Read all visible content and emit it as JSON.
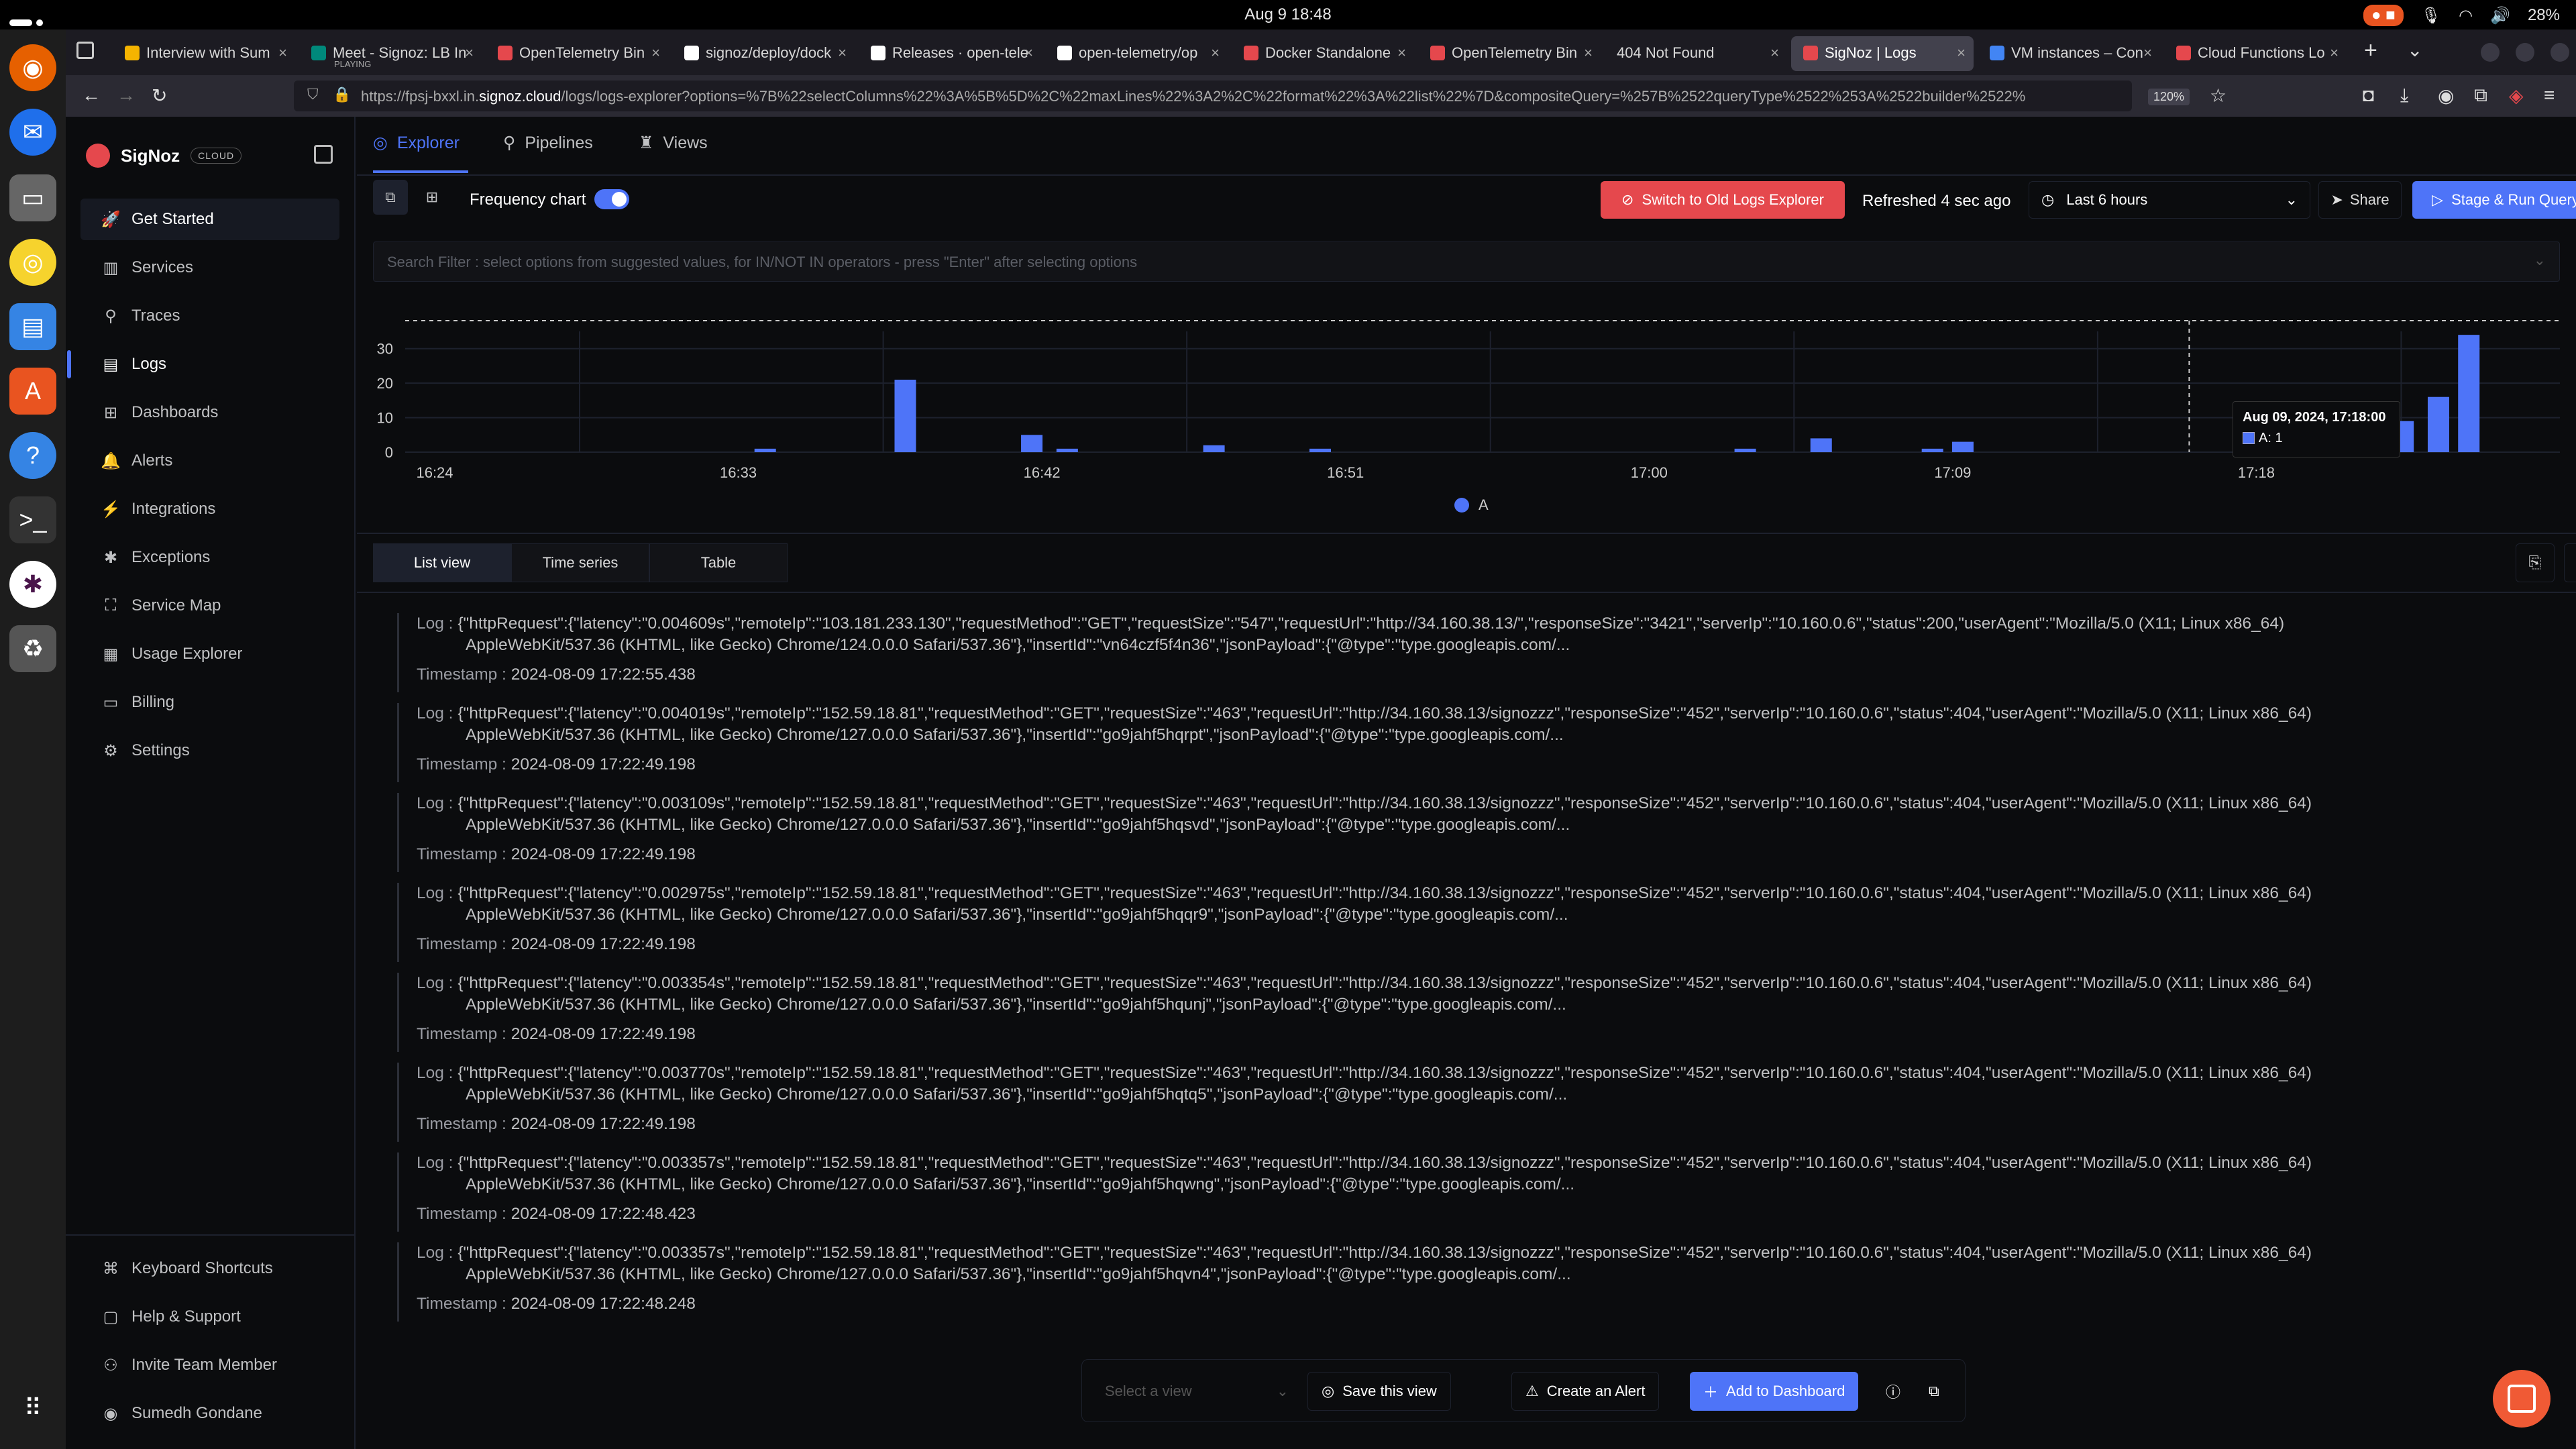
{
  "os": {
    "clock": "Aug 9  18:48",
    "battery": "28%"
  },
  "browser": {
    "tabs": [
      {
        "title": "Interview with Sum",
        "color": "#f5b400"
      },
      {
        "title": "Meet - Signoz: LB In",
        "sub": "PLAYING",
        "color": "#00897b"
      },
      {
        "title": "OpenTelemetry Bin",
        "color": "#e5484d"
      },
      {
        "title": "signoz/deploy/dock",
        "color": "#ffffff"
      },
      {
        "title": "Releases · open-tele",
        "color": "#ffffff"
      },
      {
        "title": "open-telemetry/op",
        "color": "#ffffff"
      },
      {
        "title": "Docker Standalone",
        "color": "#e5484d"
      },
      {
        "title": "OpenTelemetry Bin",
        "color": "#e5484d"
      },
      {
        "title": "404 Not Found",
        "color": ""
      },
      {
        "title": "SigNoz | Logs",
        "color": "#e5484d"
      },
      {
        "title": "VM instances – Con",
        "color": "#4285f4"
      },
      {
        "title": "Cloud Functions Lo",
        "color": "#e5484d"
      }
    ],
    "url_prefix": "https://fpsj-bxxl.in.",
    "url_domain": "signoz.cloud",
    "url_rest": "/logs/logs-explorer?options=%7B%22selectColumns%22%3A%5B%5D%2C%22maxLines%22%3A2%2C%22format%22%3A%22list%22%7D&compositeQuery=%257B%2522queryType%2522%253A%2522builder%2522%",
    "zoom": "120%"
  },
  "sidebar": {
    "brand": "SigNoz",
    "badge": "CLOUD",
    "items": [
      {
        "label": "Get Started",
        "icon": "rocket-icon",
        "glyph": "🚀"
      },
      {
        "label": "Services",
        "icon": "bar-chart-icon",
        "glyph": "▥"
      },
      {
        "label": "Traces",
        "icon": "traces-icon",
        "glyph": "⚲"
      },
      {
        "label": "Logs",
        "icon": "logs-icon",
        "glyph": "▤"
      },
      {
        "label": "Dashboards",
        "icon": "dashboard-icon",
        "glyph": "⊞"
      },
      {
        "label": "Alerts",
        "icon": "bell-icon",
        "glyph": "🔔"
      },
      {
        "label": "Integrations",
        "icon": "plug-icon",
        "glyph": "⚡"
      },
      {
        "label": "Exceptions",
        "icon": "bug-icon",
        "glyph": "✱"
      },
      {
        "label": "Service Map",
        "icon": "map-icon",
        "glyph": "⛶"
      },
      {
        "label": "Usage Explorer",
        "icon": "usage-icon",
        "glyph": "▦"
      },
      {
        "label": "Billing",
        "icon": "billing-icon",
        "glyph": "▭"
      },
      {
        "label": "Settings",
        "icon": "gear-icon",
        "glyph": "⚙"
      }
    ],
    "bottom": [
      {
        "label": "Keyboard Shortcuts",
        "icon": "keyboard-icon",
        "glyph": "⌘"
      },
      {
        "label": "Help & Support",
        "icon": "help-icon",
        "glyph": "▢"
      },
      {
        "label": "Invite Team Member",
        "icon": "invite-icon",
        "glyph": "⚇"
      },
      {
        "label": "Sumedh Gondane",
        "icon": "user-icon",
        "glyph": "◉"
      }
    ]
  },
  "header": {
    "tabs": [
      "Explorer",
      "Pipelines",
      "Views"
    ],
    "frequency_label": "Frequency chart",
    "switch_label": "Switch to Old Logs Explorer",
    "refreshed": "Refreshed 4 sec ago",
    "time_range": "Last 6 hours",
    "share": "Share",
    "run": "Stage & Run Query",
    "search_placeholder": "Search Filter : select options from suggested values, for IN/NOT IN operators - press \"Enter\" after selecting options"
  },
  "chart_data": {
    "type": "bar",
    "series": [
      {
        "name": "A",
        "color": "#4e74f8"
      }
    ],
    "yticks": [
      0,
      10,
      20,
      30
    ],
    "ylim": [
      0,
      35
    ],
    "xticks": [
      "16:24",
      "16:33",
      "16:42",
      "16:51",
      "17:00",
      "17:09",
      "17:18"
    ],
    "tooltip": {
      "time": "Aug 09, 2024, 17:18:00",
      "value": "A: 1"
    },
    "bars": [
      {
        "x": 16.33,
        "v": 1
      },
      {
        "x": 23.25,
        "v": 21
      },
      {
        "x": 29.5,
        "v": 5
      },
      {
        "x": 31.25,
        "v": 1
      },
      {
        "x": 38.5,
        "v": 2
      },
      {
        "x": 43.75,
        "v": 1
      },
      {
        "x": 64.75,
        "v": 1
      },
      {
        "x": 68.5,
        "v": 4
      },
      {
        "x": 74.0,
        "v": 1
      },
      {
        "x": 75.5,
        "v": 3
      },
      {
        "x": 94.5,
        "v": 1
      },
      {
        "x": 97.25,
        "v": 9
      },
      {
        "x": 99.0,
        "v": 16
      },
      {
        "x": 100.5,
        "v": 34
      }
    ]
  },
  "views": {
    "tabs": [
      "List view",
      "Time series",
      "Table"
    ]
  },
  "logs": [
    {
      "line1": "{\"httpRequest\":{\"latency\":\"0.004609s\",\"remoteIp\":\"103.181.233.130\",\"requestMethod\":\"GET\",\"requestSize\":\"547\",\"requestUrl\":\"http://34.160.38.13/\",\"responseSize\":\"3421\",\"serverIp\":\"10.160.0.6\",\"status\":200,\"userAgent\":\"Mozilla/5.0 (X11; Linux x86_64)",
      "line2": "AppleWebKit/537.36 (KHTML, like Gecko) Chrome/124.0.0.0 Safari/537.36\"},\"insertId\":\"vn64czf5f4n36\",\"jsonPayload\":{\"@type\":\"type.googleapis.com/...",
      "ts": "2024-08-09 17:22:55.438"
    },
    {
      "line1": "{\"httpRequest\":{\"latency\":\"0.004019s\",\"remoteIp\":\"152.59.18.81\",\"requestMethod\":\"GET\",\"requestSize\":\"463\",\"requestUrl\":\"http://34.160.38.13/signozzz\",\"responseSize\":\"452\",\"serverIp\":\"10.160.0.6\",\"status\":404,\"userAgent\":\"Mozilla/5.0 (X11; Linux x86_64)",
      "line2": "AppleWebKit/537.36 (KHTML, like Gecko) Chrome/127.0.0.0 Safari/537.36\"},\"insertId\":\"go9jahf5hqrpt\",\"jsonPayload\":{\"@type\":\"type.googleapis.com/...",
      "ts": "2024-08-09 17:22:49.198"
    },
    {
      "line1": "{\"httpRequest\":{\"latency\":\"0.003109s\",\"remoteIp\":\"152.59.18.81\",\"requestMethod\":\"GET\",\"requestSize\":\"463\",\"requestUrl\":\"http://34.160.38.13/signozzz\",\"responseSize\":\"452\",\"serverIp\":\"10.160.0.6\",\"status\":404,\"userAgent\":\"Mozilla/5.0 (X11; Linux x86_64)",
      "line2": "AppleWebKit/537.36 (KHTML, like Gecko) Chrome/127.0.0.0 Safari/537.36\"},\"insertId\":\"go9jahf5hqsvd\",\"jsonPayload\":{\"@type\":\"type.googleapis.com/...",
      "ts": "2024-08-09 17:22:49.198"
    },
    {
      "line1": "{\"httpRequest\":{\"latency\":\"0.002975s\",\"remoteIp\":\"152.59.18.81\",\"requestMethod\":\"GET\",\"requestSize\":\"463\",\"requestUrl\":\"http://34.160.38.13/signozzz\",\"responseSize\":\"452\",\"serverIp\":\"10.160.0.6\",\"status\":404,\"userAgent\":\"Mozilla/5.0 (X11; Linux x86_64)",
      "line2": "AppleWebKit/537.36 (KHTML, like Gecko) Chrome/127.0.0.0 Safari/537.36\"},\"insertId\":\"go9jahf5hqqr9\",\"jsonPayload\":{\"@type\":\"type.googleapis.com/...",
      "ts": "2024-08-09 17:22:49.198"
    },
    {
      "line1": "{\"httpRequest\":{\"latency\":\"0.003354s\",\"remoteIp\":\"152.59.18.81\",\"requestMethod\":\"GET\",\"requestSize\":\"463\",\"requestUrl\":\"http://34.160.38.13/signozzz\",\"responseSize\":\"452\",\"serverIp\":\"10.160.0.6\",\"status\":404,\"userAgent\":\"Mozilla/5.0 (X11; Linux x86_64)",
      "line2": "AppleWebKit/537.36 (KHTML, like Gecko) Chrome/127.0.0.0 Safari/537.36\"},\"insertId\":\"go9jahf5hqunj\",\"jsonPayload\":{\"@type\":\"type.googleapis.com/...",
      "ts": "2024-08-09 17:22:49.198"
    },
    {
      "line1": "{\"httpRequest\":{\"latency\":\"0.003770s\",\"remoteIp\":\"152.59.18.81\",\"requestMethod\":\"GET\",\"requestSize\":\"463\",\"requestUrl\":\"http://34.160.38.13/signozzz\",\"responseSize\":\"452\",\"serverIp\":\"10.160.0.6\",\"status\":404,\"userAgent\":\"Mozilla/5.0 (X11; Linux x86_64)",
      "line2": "AppleWebKit/537.36 (KHTML, like Gecko) Chrome/127.0.0.0 Safari/537.36\"},\"insertId\":\"go9jahf5hqtq5\",\"jsonPayload\":{\"@type\":\"type.googleapis.com/...",
      "ts": "2024-08-09 17:22:49.198"
    },
    {
      "line1": "{\"httpRequest\":{\"latency\":\"0.003357s\",\"remoteIp\":\"152.59.18.81\",\"requestMethod\":\"GET\",\"requestSize\":\"463\",\"requestUrl\":\"http://34.160.38.13/signozzz\",\"responseSize\":\"452\",\"serverIp\":\"10.160.0.6\",\"status\":404,\"userAgent\":\"Mozilla/5.0 (X11; Linux x86_64)",
      "line2": "AppleWebKit/537.36 (KHTML, like Gecko) Chrome/127.0.0.0 Safari/537.36\"},\"insertId\":\"go9jahf5hqwng\",\"jsonPayload\":{\"@type\":\"type.googleapis.com/...",
      "ts": "2024-08-09 17:22:48.423"
    },
    {
      "line1": "{\"httpRequest\":{\"latency\":\"0.003357s\",\"remoteIp\":\"152.59.18.81\",\"requestMethod\":\"GET\",\"requestSize\":\"463\",\"requestUrl\":\"http://34.160.38.13/signozzz\",\"responseSize\":\"452\",\"serverIp\":\"10.160.0.6\",\"status\":404,\"userAgent\":\"Mozilla/5.0 (X11; Linux x86_64)",
      "line2": "AppleWebKit/537.36 (KHTML, like Gecko) Chrome/127.0.0.0 Safari/537.36\"},\"insertId\":\"go9jahf5hqvn4\",\"jsonPayload\":{\"@type\":\"type.googleapis.com/...",
      "ts": "2024-08-09 17:22:48.248"
    }
  ],
  "log_labels": {
    "log": "Log :",
    "timestamp": "Timestamp :"
  },
  "bottom": {
    "select_placeholder": "Select a view",
    "save": "Save this view",
    "alert": "Create an Alert",
    "dashboard": "Add to Dashboard"
  },
  "colors": {
    "accent": "#4e74f8",
    "danger": "#e5484d"
  }
}
